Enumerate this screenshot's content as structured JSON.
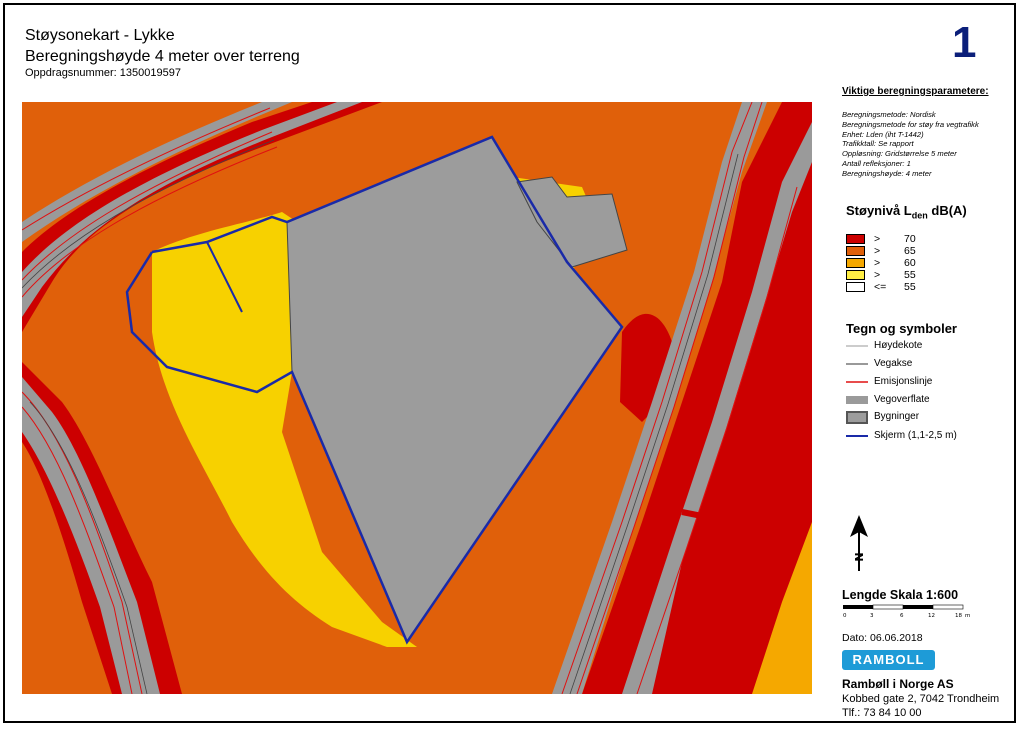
{
  "header": {
    "title": "Støysonekart - Lykke",
    "subtitle": "Beregningshøyde 4 meter over terreng",
    "assignment": "Oppdragsnummer:  1350019597",
    "sheet_number": "1"
  },
  "parameters": {
    "heading": "Viktige beregningsparametere:",
    "lines": [
      "Beregningsmetode: Nordisk",
      "Beregningsmetode for støy fra vegtrafikk",
      "Enhet: Lden (iht T-1442)",
      "Trafikktall: Se rapport",
      "Oppløsning: Gridstørrelse 5 meter",
      "Antall refleksjoner: 1",
      "Beregningshøyde: 4 meter"
    ]
  },
  "noise_legend": {
    "heading_prefix": "Støynivå L",
    "heading_sub": "den",
    "heading_suffix": "  dB(A)",
    "levels": [
      {
        "op": ">",
        "value": "70",
        "color": "#cc0000"
      },
      {
        "op": ">",
        "value": "65",
        "color": "#e0600a"
      },
      {
        "op": ">",
        "value": "60",
        "color": "#f5a800"
      },
      {
        "op": ">",
        "value": "55",
        "color": "#ffee44"
      },
      {
        "op": "<=",
        "value": "55",
        "color": "#ffffff"
      }
    ]
  },
  "symbols": {
    "heading": "Tegn og symboler",
    "items": [
      {
        "label": "Høydekote",
        "icon": "contour-line"
      },
      {
        "label": "Vegakse",
        "icon": "road-axis-line"
      },
      {
        "label": "Emisjonslinje",
        "icon": "emission-line"
      },
      {
        "label": "Vegoverflate",
        "icon": "road-surface"
      },
      {
        "label": "Bygninger",
        "icon": "building"
      },
      {
        "label": "Skjerm (1,1-2,5 m)",
        "icon": "screen-line"
      }
    ]
  },
  "scale": {
    "heading": "Lengde Skala 1:600",
    "ticks": [
      "0",
      "3",
      "6",
      "12",
      "18"
    ],
    "unit": "m"
  },
  "north_label": "N",
  "date": "Dato: 06.06.2018",
  "company": {
    "logo": "RAMBOLL",
    "name": "Rambøll i Norge AS",
    "address": "Kobbed gate 2, 7042 Trondheim",
    "phone": "Tlf.: 73 84 10 00"
  },
  "colors": {
    "lvl70": "#cc0000",
    "lvl65": "#e0600a",
    "lvl60": "#f5a800",
    "lvl55": "#ffee44",
    "quiet": "#f7d100",
    "road": "#9a9a9a",
    "building": "#9c9c9c",
    "screen": "#1a2aa8",
    "emission": "#e01010"
  }
}
